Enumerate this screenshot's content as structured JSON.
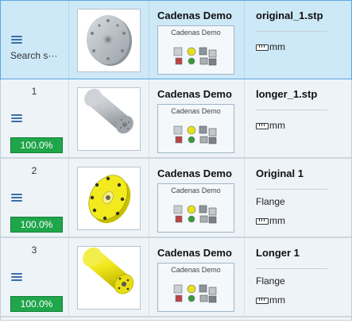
{
  "results": [
    {
      "rank": "",
      "menu_icon": "hamburger-menu-icon",
      "search_label": "Search s···",
      "score": "",
      "thumbnail": "flat-disc-flange-icon",
      "brand": "Cadenas Demo",
      "brand_logo_text": "Cadenas Demo",
      "title": "original_1.stp",
      "subtitle": "",
      "unit": "mm",
      "unit_icon": "ruler-icon",
      "selected": true
    },
    {
      "rank": "1",
      "menu_icon": "hamburger-menu-icon",
      "search_label": "",
      "score": "100.0%",
      "thumbnail": "long-cylinder-icon",
      "brand": "Cadenas Demo",
      "brand_logo_text": "Cadenas Demo",
      "title": "longer_1.stp",
      "subtitle": "",
      "unit": "mm",
      "unit_icon": "ruler-icon",
      "selected": false
    },
    {
      "rank": "2",
      "menu_icon": "hamburger-menu-icon",
      "search_label": "",
      "score": "100.0%",
      "thumbnail": "yellow-flange-icon",
      "brand": "Cadenas Demo",
      "brand_logo_text": "Cadenas Demo",
      "title": "Original 1",
      "subtitle": "Flange",
      "unit": "mm",
      "unit_icon": "ruler-icon",
      "selected": false
    },
    {
      "rank": "3",
      "menu_icon": "hamburger-menu-icon",
      "search_label": "",
      "score": "100.0%",
      "thumbnail": "yellow-cylinder-icon",
      "brand": "Cadenas Demo",
      "brand_logo_text": "Cadenas Demo",
      "title": "Longer 1",
      "subtitle": "Flange",
      "unit": "mm",
      "unit_icon": "ruler-icon",
      "selected": false
    }
  ],
  "colors": {
    "score_green": "#1fa64a",
    "selected_row": "#cde8f7",
    "row_bg": "#eef3f8",
    "part_yellow": "#f2ea1c",
    "part_gray": "#b9bec4"
  }
}
